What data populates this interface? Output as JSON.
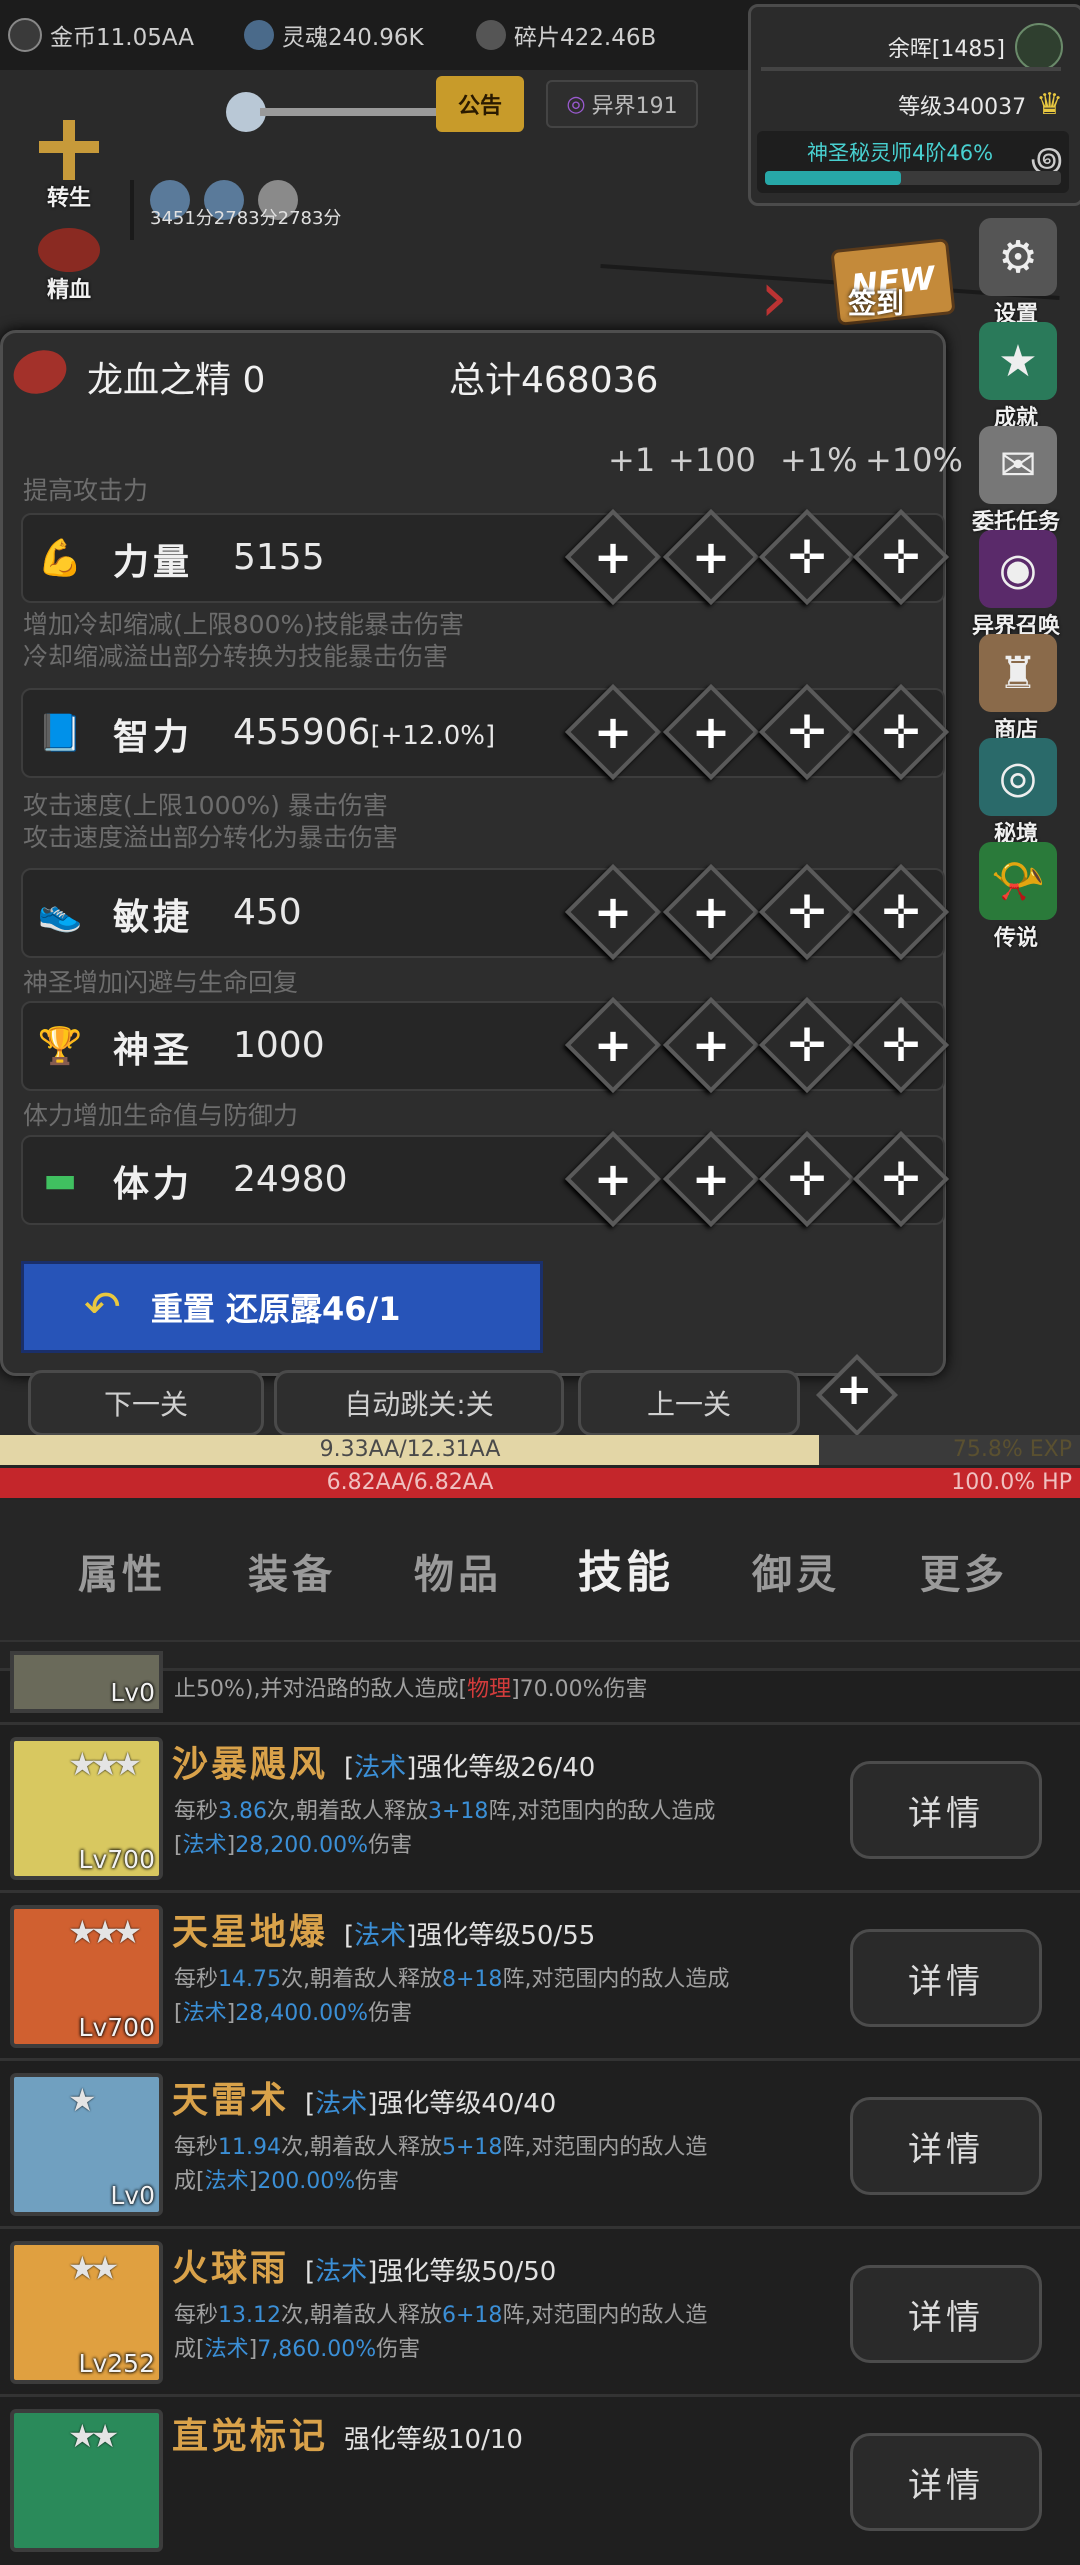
{
  "resources": {
    "gold": "金币11.05AA",
    "soul": "灵魂240.96K",
    "shard": "碎片422.46B",
    "notice": "公告",
    "otherworld": "异界191",
    "leftover": "余晖[1485]",
    "level": "等级340037",
    "rank": "神圣秘灵师4阶46%",
    "rank_progress": 0.46
  },
  "scene": {
    "rebirth_label": "转生",
    "essence_label": "精血",
    "dps_values": "3451分2783分2783分",
    "signin_new": "NEW",
    "signin_label": "签到"
  },
  "side_menu": [
    {
      "label": "设置",
      "icon": "gear-icon"
    },
    {
      "label": "成就",
      "icon": "star-icon"
    },
    {
      "label": "委托任务",
      "icon": "scroll-icon"
    },
    {
      "label": "异界召唤",
      "icon": "portal-icon"
    },
    {
      "label": "商店",
      "icon": "bag-icon"
    },
    {
      "label": "秘境",
      "icon": "vortex-icon"
    },
    {
      "label": "传说",
      "icon": "horn-icon"
    }
  ],
  "panel": {
    "essence_label": "龙血之精 0",
    "total_label": "总计468036",
    "increments": [
      "+1",
      "+100",
      "+1%",
      "+10%"
    ],
    "attributes": [
      {
        "desc1": "提高攻击力",
        "desc2": "",
        "name": "力量",
        "value": "5155",
        "bonus": "",
        "icon": "arm-icon"
      },
      {
        "desc1": "增加冷却缩减(上限800%)技能暴击伤害",
        "desc2": "冷却缩减溢出部分转换为技能暴击伤害",
        "name": "智力",
        "value": "455906",
        "bonus": "[+12.0%]",
        "icon": "book-icon"
      },
      {
        "desc1": "攻击速度(上限1000%) 暴击伤害",
        "desc2": "攻击速度溢出部分转化为暴击伤害",
        "name": "敏捷",
        "value": "450",
        "bonus": "",
        "icon": "boot-icon"
      },
      {
        "desc1": "神圣增加闪避与生命回复",
        "desc2": "",
        "name": "神圣",
        "value": "1000",
        "bonus": "",
        "icon": "trophy-icon"
      },
      {
        "desc1": "体力增加生命值与防御力",
        "desc2": "",
        "name": "体力",
        "value": "24980",
        "bonus": "",
        "icon": "bar-icon"
      }
    ],
    "reset_label": "重置 还原露46/1"
  },
  "nav": {
    "next": "下一关",
    "auto": "自动跳关:关",
    "prev": "上一关"
  },
  "exp": {
    "text": "9.33AA/12.31AA",
    "percent": "75.8% EXP",
    "fill": 0.758
  },
  "hp": {
    "text": "6.82AA/6.82AA",
    "percent": "100.0% HP",
    "fill": 1.0
  },
  "tabs": [
    "属性",
    "装备",
    "物品",
    "技能",
    "御灵",
    "更多"
  ],
  "active_tab": "技能",
  "skills": [
    {
      "name": "",
      "lv": "Lv0",
      "stars": "",
      "tag": "",
      "enh": "",
      "desc_a": "止50%),并对沿路的敌人造成[",
      "type": "物理",
      "desc_b": "]70.00%伤害",
      "line2": "",
      "button": ""
    },
    {
      "name": "沙暴飓风",
      "lv": "Lv700",
      "stars": "★★★",
      "tag": "法术",
      "enh": "强化等级26/40",
      "desc_a": "每秒",
      "rate": "3.86",
      "desc_mid": "次,朝着敌人释放",
      "count": "3+18",
      "desc_end": "阵,对范围内的敌人造成",
      "type": "法术",
      "dmg": "28,200.00%",
      "dmg_suffix": "伤害",
      "button": "详情"
    },
    {
      "name": "天星地爆",
      "lv": "Lv700",
      "stars": "★★★",
      "tag": "法术",
      "enh": "强化等级50/55",
      "desc_a": "每秒",
      "rate": "14.75",
      "desc_mid": "次,朝着敌人释放",
      "count": "8+18",
      "desc_end": "阵,对范围内的敌人造成",
      "type": "法术",
      "dmg": "28,400.00%",
      "dmg_suffix": "伤害",
      "button": "详情"
    },
    {
      "name": "天雷术",
      "lv": "Lv0",
      "stars": "★",
      "tag": "法术",
      "enh": "强化等级40/40",
      "desc_a": "每秒",
      "rate": "11.94",
      "desc_mid": "次,朝着敌人释放",
      "count": "5+18",
      "desc_end": "阵,对范围内的敌人造",
      "type": "法术",
      "dmg": "200.00%",
      "dmg_suffix": "伤害",
      "line_prefix": "成",
      "button": "详情"
    },
    {
      "name": "火球雨",
      "lv": "Lv252",
      "stars": "★★",
      "tag": "法术",
      "enh": "强化等级50/50",
      "desc_a": "每秒",
      "rate": "13.12",
      "desc_mid": "次,朝着敌人释放",
      "count": "6+18",
      "desc_end": "阵,对范围内的敌人造",
      "type": "法术",
      "dmg": "7,860.00%",
      "dmg_suffix": "伤害",
      "line_prefix": "成",
      "button": "详情"
    },
    {
      "name": "直觉标记",
      "lv": "",
      "stars": "★★",
      "tag": "",
      "enh": "强化等级10/10",
      "button": "详情"
    }
  ],
  "colors": {
    "blue_button": "#2754b8",
    "gold_text": "#d9a24a",
    "exp_bar": "#e3d6a6",
    "hp_bar": "#c4262b",
    "type_blue": "#3b8fd6"
  }
}
